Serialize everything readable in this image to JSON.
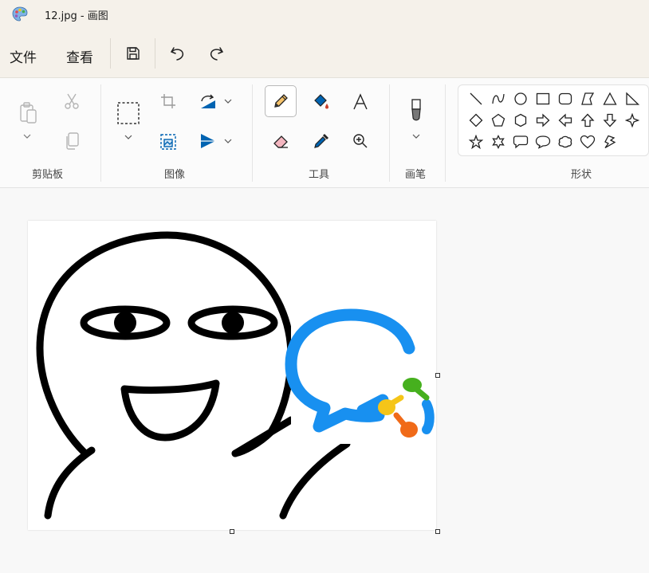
{
  "window": {
    "title": "12.jpg - 画图"
  },
  "menu": {
    "file": "文件",
    "view": "查看"
  },
  "ribbon": {
    "groups": {
      "clipboard": "剪贴板",
      "image": "图像",
      "tools": "工具",
      "brushes": "画笔",
      "shapes": "形状"
    }
  },
  "colors": {
    "accent": "#0063b1",
    "titlebar": "#f5f1ea",
    "canvas_bg": "#f8f8f8"
  }
}
